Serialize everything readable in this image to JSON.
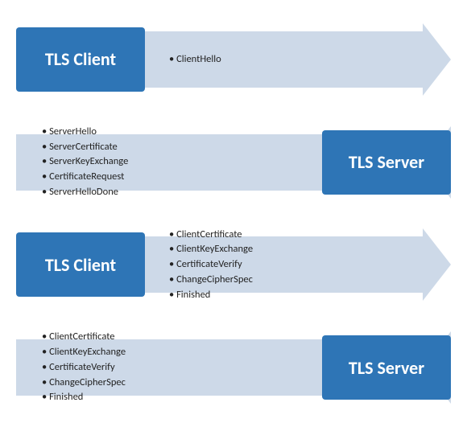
{
  "rows": [
    {
      "id": "row1",
      "direction": "right",
      "actor": "TLS Client",
      "actor_side": "left",
      "messages": [
        "ClientHello"
      ]
    },
    {
      "id": "row2",
      "direction": "left",
      "actor": "TLS Server",
      "actor_side": "right",
      "messages": [
        "ServerHello",
        "ServerCertificate",
        "ServerKeyExchange",
        "CertificateRequest",
        "ServerHelloDone"
      ]
    },
    {
      "id": "row3",
      "direction": "right",
      "actor": "TLS Client",
      "actor_side": "left",
      "messages": [
        "ClientCertificate",
        "ClientKeyExchange",
        "CertificateVerify",
        "ChangeCipherSpec",
        "Finished"
      ]
    },
    {
      "id": "row4",
      "direction": "left",
      "actor": "TLS Server",
      "actor_side": "right",
      "messages": [
        "ClientCertificate",
        "ClientKeyExchange",
        "CertificateVerify",
        "ChangeCipherSpec",
        "Finished"
      ]
    }
  ]
}
